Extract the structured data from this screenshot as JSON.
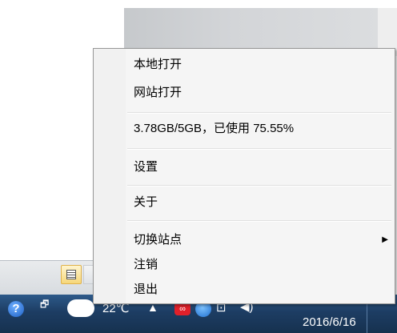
{
  "menu": {
    "items": [
      {
        "label": "本地打开"
      },
      {
        "label": "网站打开"
      },
      {
        "label": "3.78GB/5GB，已使用 75.55%"
      },
      {
        "label": "设置"
      },
      {
        "label": "关于"
      },
      {
        "label": "切换站点",
        "submenu_arrow": "▶"
      },
      {
        "label": "注销"
      },
      {
        "label": "退出"
      }
    ]
  },
  "taskbar": {
    "help_glyph": "?",
    "temperature": "22℃",
    "clock_date": "2016/6/16",
    "tray_up_arrow": "▲",
    "icons": [
      "help-icon",
      "cloud-weather-icon",
      "red-app-icon",
      "blue-app-icon",
      "network-icon",
      "volume-icon"
    ]
  },
  "colors": {
    "taskbar": "#1d3d63",
    "menu_bg": "#f5f5f5",
    "menu_border": "#979797"
  }
}
